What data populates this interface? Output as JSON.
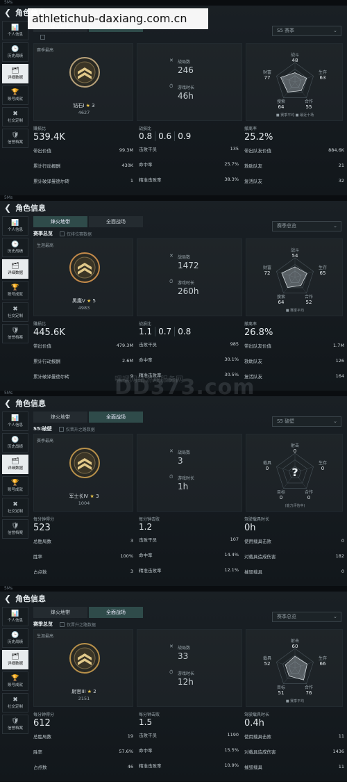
{
  "watermark_top": "athletichub-daxiang.com.cn",
  "watermark_mid": "DD373.com",
  "watermark_mid_small": "嘿嘿网络游戏服务网",
  "sidebar_labels": [
    "个人信息",
    "历史战绩",
    "详细数据",
    "账号成就",
    "社交定制",
    "信誉档案"
  ],
  "panels": [
    {
      "header": "角色信息",
      "status": "5Ms",
      "tab1": "烽火地带",
      "tab2": "全面战场",
      "active_tab": 2,
      "subtitle": "",
      "check_label": "",
      "dropdown": "S5 赛季",
      "season_label": "赛季最高",
      "rank_name": "钻石I",
      "rank_stars": "3",
      "rank_score": "4627",
      "c2_lbl1": "战局数",
      "c2_val1": "246",
      "c2_lbl2": "游戏时长",
      "c2_val2": "46h",
      "radar": {
        "top": [
          "战斗",
          "48"
        ],
        "right": [
          "生存",
          "63"
        ],
        "rb": [
          "合作",
          "55"
        ],
        "lb": [
          "搜索",
          "64"
        ],
        "left": [
          "财富",
          "77"
        ],
        "mode": "full",
        "legend": "■ 赛季平均    ■ 最近十场"
      },
      "col1": {
        "head_lbl": "赚损比",
        "head_val": "539.4K",
        "rows": [
          [
            "带出价值",
            "99.3M"
          ],
          [
            "累计行动报酬",
            "430K"
          ],
          [
            "累计破译曼德尔砖",
            "1"
          ]
        ]
      },
      "col2": {
        "head_lbl": "战损比",
        "kd": [
          "0.8",
          "0.6",
          "0.9"
        ],
        "rows": [
          [
            "击败干员",
            "135"
          ],
          [
            "命中率",
            "25.7%"
          ],
          [
            "精准击败率",
            "38.3%"
          ]
        ]
      },
      "col3": {
        "head_lbl": "撤离率",
        "head_val": "25.2%",
        "rows": [
          [
            "带出队友价值",
            "884.6K"
          ],
          [
            "救助队友",
            "21"
          ],
          [
            "复活队友",
            "32"
          ]
        ]
      }
    },
    {
      "header": "角色信息",
      "status": "5Ms",
      "tab1": "烽火地带",
      "tab2": "全面战场",
      "active_tab": 1,
      "subtitle": "赛季总览",
      "check_label": "仅排位赛数据",
      "dropdown": "赛季总览",
      "season_label": "生涯最高",
      "rank_name": "黑鹰V",
      "rank_stars": "5",
      "rank_score": "4983",
      "c2_lbl1": "战局数",
      "c2_val1": "1472",
      "c2_lbl2": "游戏时长",
      "c2_val2": "260h",
      "radar": {
        "top": [
          "战斗",
          "54"
        ],
        "right": [
          "生存",
          "65"
        ],
        "rb": [
          "合作",
          "52"
        ],
        "lb": [
          "搜索",
          "64"
        ],
        "left": [
          "财富",
          "72"
        ],
        "mode": "full",
        "legend": "■ 赛季平均"
      },
      "col1": {
        "head_lbl": "赚损比",
        "head_val": "445.6K",
        "rows": [
          [
            "带出价值",
            "479.3M"
          ],
          [
            "累计行动报酬",
            "2.6M"
          ],
          [
            "累计破译曼德尔砖",
            "9"
          ]
        ]
      },
      "col2": {
        "head_lbl": "战损比",
        "kd": [
          "1.1",
          "0.7",
          "0.8"
        ],
        "rows": [
          [
            "击败干员",
            "985"
          ],
          [
            "命中率",
            "30.1%"
          ],
          [
            "精准击败率",
            "30.5%"
          ]
        ]
      },
      "col3": {
        "head_lbl": "撤离率",
        "head_val": "26.8%",
        "rows": [
          [
            "带出队友价值",
            "1.7M"
          ],
          [
            "救助队友",
            "126"
          ],
          [
            "复活队友",
            "164"
          ]
        ]
      }
    },
    {
      "header": "角色信息",
      "status": "5Ms",
      "tab1": "烽火地带",
      "tab2": "全面战场",
      "active_tab": 2,
      "subtitle": "S5:破壁",
      "check_label": "仅晋升之路数据",
      "dropdown": "S5 破壁",
      "season_label": "赛季最高",
      "rank_name": "军士长IV",
      "rank_stars": "3",
      "rank_score": "1004",
      "c2_lbl1": "战局数",
      "c2_val1": "3",
      "c2_lbl2": "游戏时长",
      "c2_val2": "1h",
      "radar": {
        "top": [
          "射击",
          "0"
        ],
        "right": [
          "生存",
          "0"
        ],
        "rb": [
          "合作",
          "0"
        ],
        "lb": [
          "目标",
          "0"
        ],
        "left": [
          "载具",
          "0"
        ],
        "mode": "unknown",
        "legend": "(能力评估中)"
      },
      "col1": {
        "head_lbl": "每分钟得分",
        "head_val": "523",
        "rows": [
          [
            "总胜局数",
            "3"
          ],
          [
            "胜率",
            "100%"
          ],
          [
            "占点数",
            "3"
          ]
        ]
      },
      "col2": {
        "head_lbl": "每分钟击败",
        "kd": [
          "1.2"
        ],
        "rows": [
          [
            "击败干员",
            "107"
          ],
          [
            "命中率",
            "14.4%"
          ],
          [
            "精准击败率",
            "12.1%"
          ]
        ]
      },
      "col3": {
        "head_lbl": "驾驶载具时长",
        "head_val": "0h",
        "rows": [
          [
            "使用载具击败",
            "0"
          ],
          [
            "对载具造成伤害",
            "182"
          ],
          [
            "摧毁载具",
            "0"
          ]
        ]
      }
    },
    {
      "header": "角色信息",
      "status": "5Ms",
      "tab1": "烽火地带",
      "tab2": "全面战场",
      "active_tab": 2,
      "subtitle": "赛季总览",
      "check_label": "仅晋升之路数据",
      "dropdown": "赛季总览",
      "season_label": "生涯最高",
      "rank_name": "尉官III",
      "rank_stars": "2",
      "rank_score": "2151",
      "c2_lbl1": "战局数",
      "c2_val1": "33",
      "c2_lbl2": "游戏时长",
      "c2_val2": "12h",
      "radar": {
        "top": [
          "射击",
          "60"
        ],
        "right": [
          "生存",
          "66"
        ],
        "rb": [
          "合作",
          "76"
        ],
        "lb": [
          "目标",
          "51"
        ],
        "left": [
          "载具",
          "52"
        ],
        "mode": "full",
        "legend": "■ 赛季平均"
      },
      "col1": {
        "head_lbl": "每分钟得分",
        "head_val": "612",
        "rows": [
          [
            "总胜局数",
            "19"
          ],
          [
            "胜率",
            "57.6%"
          ],
          [
            "占点数",
            "46"
          ]
        ]
      },
      "col2": {
        "head_lbl": "每分钟击败",
        "kd": [
          "1.5"
        ],
        "rows": [
          [
            "击败干员",
            "1190"
          ],
          [
            "命中率",
            "15.5%"
          ],
          [
            "精准击败率",
            "10.9%"
          ]
        ]
      },
      "col3": {
        "head_lbl": "驾驶载具时长",
        "head_val": "0.4h",
        "rows": [
          [
            "使用载具击败",
            "11"
          ],
          [
            "对载具造成伤害",
            "1436"
          ],
          [
            "摧毁载具",
            "11"
          ]
        ]
      }
    }
  ]
}
